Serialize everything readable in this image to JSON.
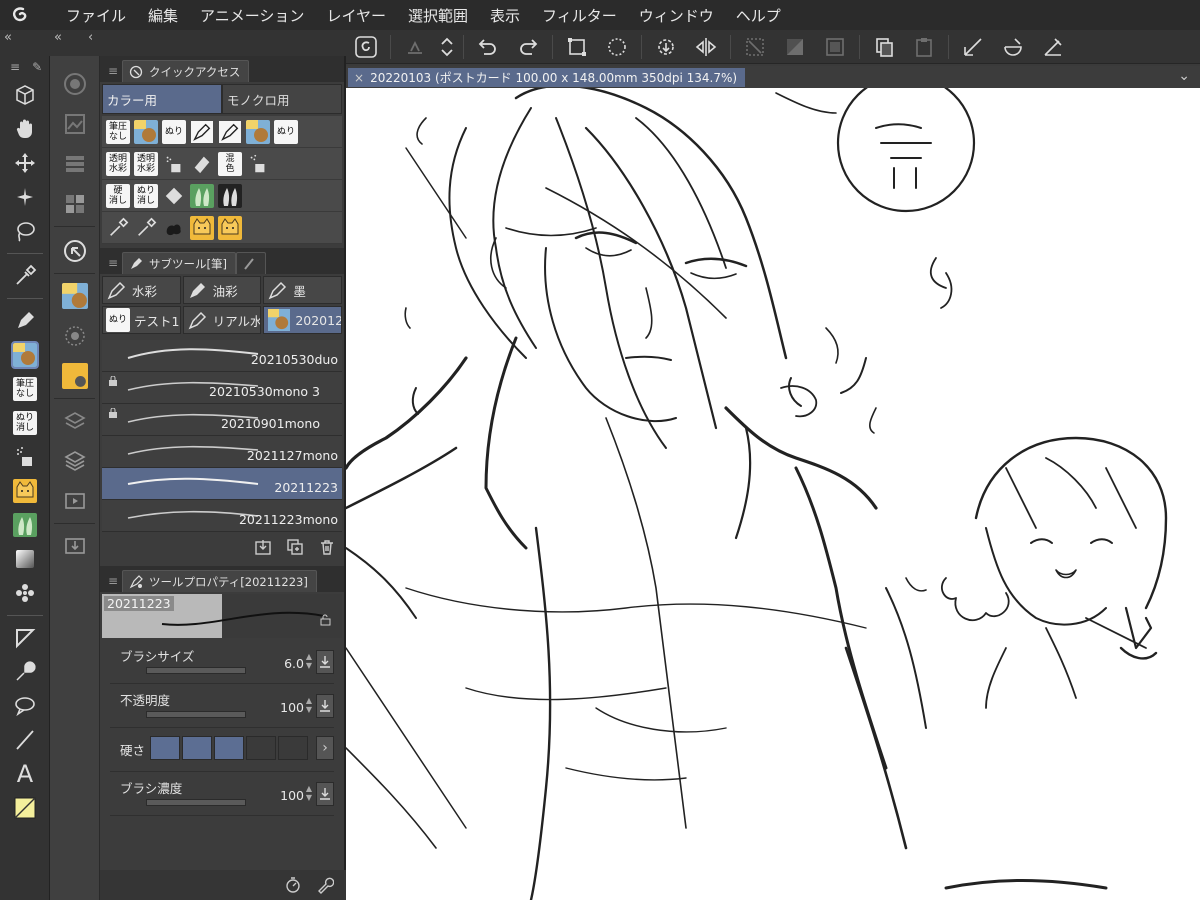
{
  "menu": [
    "ファイル",
    "編集",
    "アニメーション",
    "レイヤー",
    "選択範囲",
    "表示",
    "フィルター",
    "ウィンドウ",
    "ヘルプ"
  ],
  "collapse_glyphs": {
    "left": "«",
    "mid": "«",
    "right": "‹"
  },
  "tools": [
    {
      "name": "operation-icon"
    },
    {
      "name": "hand-icon"
    },
    {
      "name": "move-icon"
    },
    {
      "name": "auto-select-icon"
    },
    {
      "name": "lasso-icon"
    },
    {
      "name": "eyedropper-icon"
    },
    {
      "name": "pen-icon"
    },
    {
      "name": "brush-preset-icon",
      "selected": true
    },
    {
      "name": "no-pressure-icon",
      "text": "筆圧\nなし"
    },
    {
      "name": "fill-erase-icon",
      "text": "ぬり\n消し"
    },
    {
      "name": "airbrush-icon"
    },
    {
      "name": "cat-icon"
    },
    {
      "name": "blend-icon"
    },
    {
      "name": "gradient-icon"
    },
    {
      "name": "decoration-icon"
    },
    {
      "name": "figure-icon"
    },
    {
      "name": "correct-line-icon"
    },
    {
      "name": "balloon-icon"
    },
    {
      "name": "line-icon"
    },
    {
      "name": "text-icon",
      "text": "A"
    },
    {
      "name": "color-swatch-icon"
    }
  ],
  "quick_access": {
    "title": "クイックアクセス",
    "tabs": [
      "カラー用",
      "モノクロ用"
    ],
    "rows": [
      [
        "筆圧\nなし",
        "img",
        "ぬり",
        "pen",
        "pen",
        "img",
        "ぬり"
      ],
      [
        "透明\n水彩",
        "透明\n水彩",
        "air",
        "eraser",
        "混\n色",
        "air2"
      ],
      [
        "硬\n消し",
        "ぬり\n消し",
        "diamond",
        "blend",
        "blend2"
      ],
      [
        "pick",
        "pick",
        "blob",
        "cat",
        "cat"
      ]
    ]
  },
  "subtool": {
    "title": "サブツール[筆]",
    "groups": [
      "水彩",
      "油彩",
      "墨",
      "テスト1",
      "リアル水",
      "202012"
    ],
    "brushes": [
      {
        "name": "20210530duo",
        "locked": false
      },
      {
        "name": "20210530mono 3",
        "locked": true
      },
      {
        "name": "20210901mono",
        "locked": true
      },
      {
        "name": "2021127mono",
        "locked": false
      },
      {
        "name": "20211223",
        "locked": false,
        "active": true
      },
      {
        "name": "20211223mono",
        "locked": false
      }
    ]
  },
  "tool_property": {
    "title": "ツールプロパティ[20211223]",
    "preview_label": "20211223",
    "brush_size_label": "ブラシサイズ",
    "brush_size": "6.0",
    "opacity_label": "不透明度",
    "opacity": "100",
    "hardness_label": "硬さ",
    "hardness_level": 3,
    "hardness_steps": 5,
    "density_label": "ブラシ濃度",
    "density": "100"
  },
  "document": {
    "tab_label": "20220103 (ポストカード 100.00 x 148.00mm 350dpi 134.7%)",
    "close_glyph": "×",
    "menu_glyph": "⌄"
  },
  "colors": {
    "accent": "#5a6a8c",
    "panel": "#3c3c3c",
    "canvas": "#ffffff",
    "menubar": "#2b2b2b"
  }
}
